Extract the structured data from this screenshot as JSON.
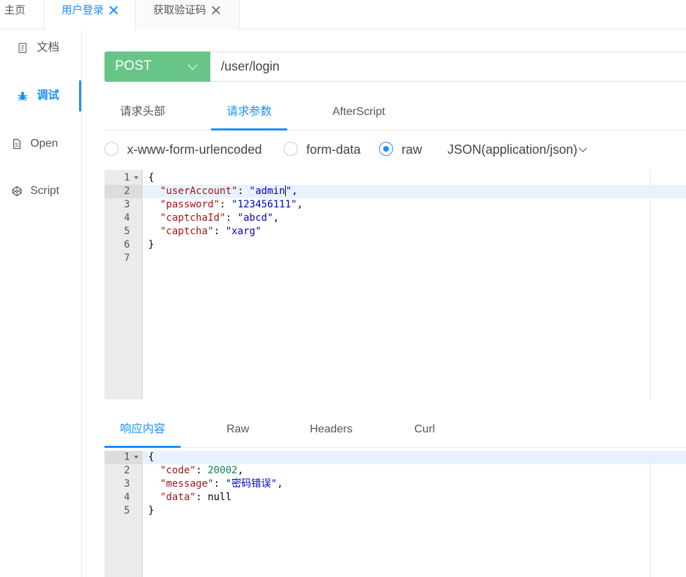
{
  "tabs": {
    "home": "主页",
    "tab1": "用户登录",
    "tab2": "获取验证码"
  },
  "sidebar": {
    "items": [
      {
        "label": "文档",
        "icon": "document-icon"
      },
      {
        "label": "调试",
        "icon": "bug-icon"
      },
      {
        "label": "Open",
        "icon": "file-icon"
      },
      {
        "label": "Script",
        "icon": "codepen-icon"
      }
    ],
    "active": "调试"
  },
  "request": {
    "method": "POST",
    "url": "/user/login",
    "tabs": [
      "请求头部",
      "请求参数",
      "AfterScript"
    ],
    "active_tab": "请求参数",
    "body_types": [
      "x-www-form-urlencoded",
      "form-data",
      "raw"
    ],
    "selected_body_type": "raw",
    "content_type": "JSON(application/json)",
    "body_lines": [
      "1",
      "2",
      "3",
      "4",
      "5",
      "6",
      "7"
    ]
  },
  "response": {
    "tabs": [
      "响应内容",
      "Raw",
      "Headers",
      "Curl"
    ],
    "active_tab": "响应内容",
    "lines": [
      "1",
      "2",
      "3",
      "4",
      "5"
    ]
  },
  "colors": {
    "accent": "#1890ff",
    "method_bg": "#67c587",
    "json_key": "#a31515",
    "json_string": "#0000cc",
    "json_number": "#098658"
  },
  "code": {
    "req_open": "{",
    "req_k1": "\"userAccount\"",
    "req_v1a": "\"admin",
    "req_v1b": "\"",
    "req_k2": "\"password\"",
    "req_v2": "\"123456111\"",
    "req_k3": "\"captchaId\"",
    "req_v3": "\"abcd\"",
    "req_k4": "\"captcha\"",
    "req_v4": "\"xarg\"",
    "req_close": "}",
    "res_open": "{",
    "res_k1": "\"code\"",
    "res_v1": "20002",
    "res_k2": "\"message\"",
    "res_v2": "\"密码错误\"",
    "res_k3": "\"data\"",
    "res_v3": "null",
    "res_close": "}",
    "colon": ": ",
    "comma": ","
  }
}
